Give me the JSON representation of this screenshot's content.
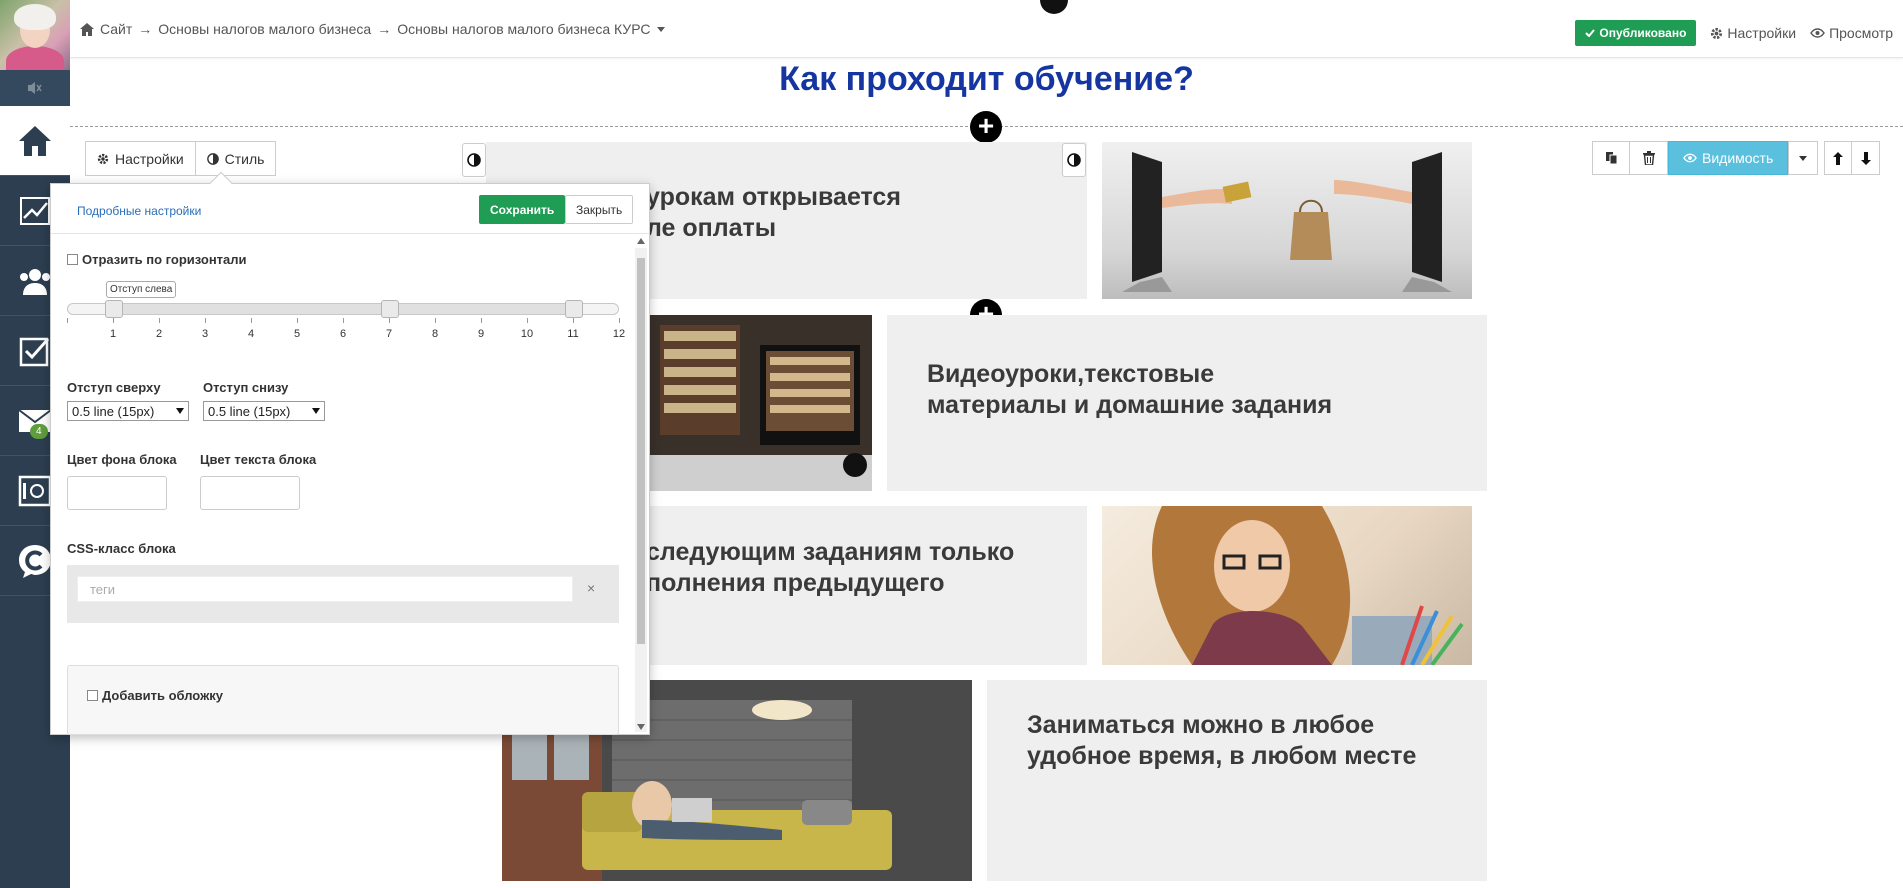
{
  "breadcrumb": {
    "items": [
      "Сайт",
      "Основы налогов малого бизнеса",
      "Основы налогов малого бизнеса КУРС"
    ],
    "separator": "→"
  },
  "topbar": {
    "published_label": "Опубликовано",
    "settings_label": "Настройки",
    "preview_label": "Просмотр"
  },
  "sidebar": {
    "mail_badge": "4"
  },
  "page": {
    "title": "Как проходит обучение?",
    "cards": [
      {
        "line1": "урокам открывается",
        "line2": "ле оплаты"
      },
      {
        "line1": "Видеоуроки,текстовые",
        "line2": "материалы и домашние задания"
      },
      {
        "line1": "следующим заданиям только",
        "line2": "полнения предыдущего"
      },
      {
        "line1": "Заниматься можно в любое",
        "line2": "удобное время, в любом месте"
      }
    ]
  },
  "block_toolbar": {
    "settings_tab": "Настройки",
    "style_tab": "Стиль",
    "visibility_label": "Видимость"
  },
  "popover": {
    "advanced_link": "Подробные настройки",
    "save_label": "Сохранить",
    "close_label": "Закрыть",
    "mirror_label": "Отразить по горизонтали",
    "slider_tooltip": "Отступ слева",
    "slider_ticks": [
      "1",
      "2",
      "3",
      "4",
      "5",
      "6",
      "7",
      "8",
      "9",
      "10",
      "11",
      "12"
    ],
    "slider_values": [
      1,
      7,
      11
    ],
    "padding_top_label": "Отступ сверху",
    "padding_top_value": "0.5 line (15px)",
    "padding_bottom_label": "Отступ снизу",
    "padding_bottom_value": "0.5 line (15px)",
    "bg_color_label": "Цвет фона блока",
    "text_color_label": "Цвет текста блока",
    "css_class_label": "CSS-класс блока",
    "tags_placeholder": "теги",
    "tags_clear": "×",
    "cover_label": "Добавить обложку"
  },
  "colors": {
    "accent_green": "#1f9d55",
    "title_blue": "#1536a0",
    "visibility_blue": "#5bc0de",
    "sidebar": "#2c3e50"
  }
}
